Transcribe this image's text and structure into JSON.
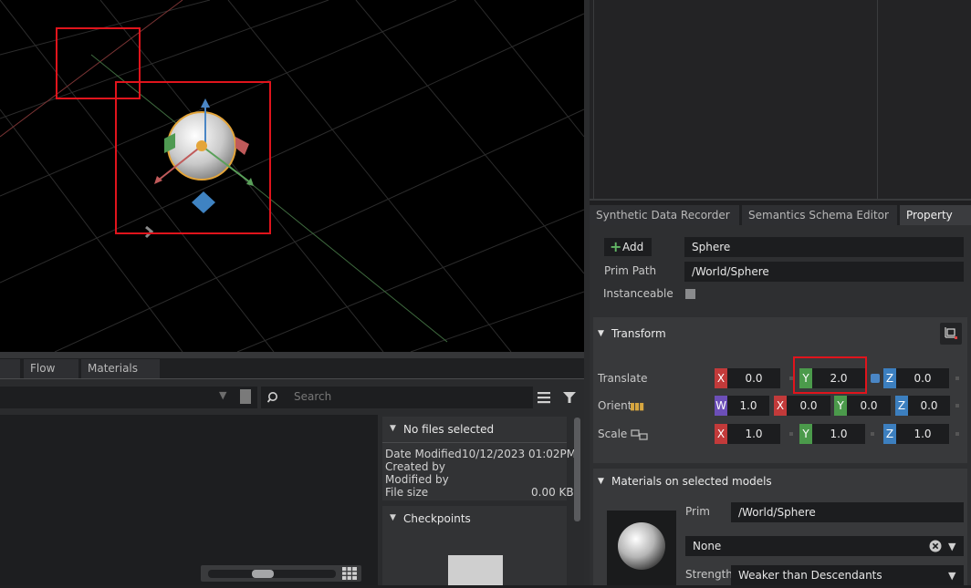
{
  "bottom_tabs": {
    "flow": "Flow",
    "materials": "Materials"
  },
  "search": {
    "placeholder": "Search"
  },
  "file_info": {
    "header": "No files selected",
    "date_modified_label": "Date Modified",
    "date_modified_value": "10/12/2023 01:02PM",
    "created_by_label": "Created by",
    "modified_by_label": "Modified by",
    "file_size_label": "File size",
    "file_size_value": "0.00 KB",
    "checkpoints_header": "Checkpoints"
  },
  "property_tabs": {
    "synthetic": "Synthetic Data Recorder",
    "semantics": "Semantics Schema Editor",
    "property": "Property"
  },
  "property": {
    "add_label": "Add",
    "name_value": "Sphere",
    "prim_path_label": "Prim Path",
    "prim_path_value": "/World/Sphere",
    "instanceable_label": "Instanceable",
    "instanceable_checked": false
  },
  "transform": {
    "header": "Transform",
    "translate_label": "Translate",
    "orient_label": "Orient",
    "scale_label": "Scale",
    "translate": {
      "x": "0.0",
      "y": "2.0",
      "z": "0.0"
    },
    "orient": {
      "w": "1.0",
      "x": "0.0",
      "y": "0.0",
      "z": "0.0"
    },
    "scale": {
      "x": "1.0",
      "y": "1.0",
      "z": "1.0"
    },
    "axis_labels": {
      "x": "X",
      "y": "Y",
      "z": "Z",
      "w": "W"
    }
  },
  "materials": {
    "header": "Materials on selected models",
    "prim_label": "Prim",
    "prim_value": "/World/Sphere",
    "material_value": "None",
    "strength_label": "Strength",
    "strength_value": "Weaker than Descendants"
  },
  "colors": {
    "highlight": "#e0141c",
    "axis_x": "#c23a3a",
    "axis_y": "#4b9a4b",
    "axis_z": "#3c7fbf",
    "axis_w": "#6c4fb8"
  }
}
